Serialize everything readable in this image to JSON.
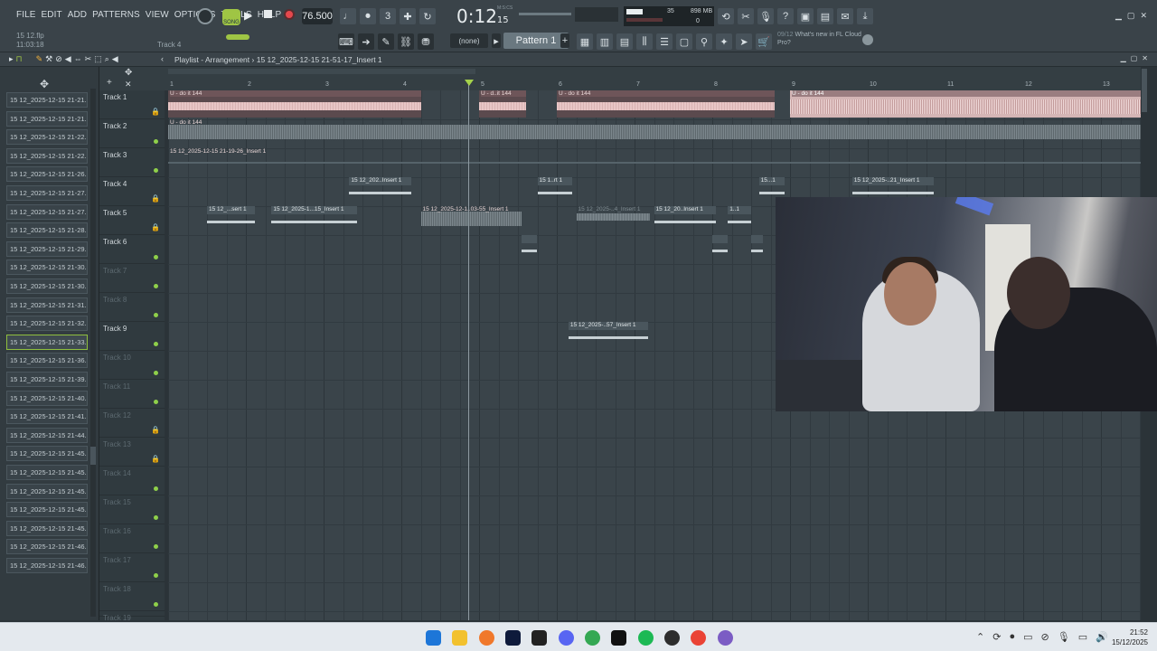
{
  "menu": [
    "FILE",
    "EDIT",
    "ADD",
    "PATTERNS",
    "VIEW",
    "OPTIONS",
    "TOOLS",
    "HELP"
  ],
  "hint": {
    "line1": "15 12.flp",
    "line2": "11:03:18",
    "track": "Track 4"
  },
  "transport": {
    "song_label": "SONG",
    "tempo": "76.500",
    "time": "0:12",
    "time_sub": "15",
    "time_unit": "M:S:CS"
  },
  "monitor": {
    "cpu": "35",
    "mem": "898 MB",
    "poly": "0"
  },
  "snap": "(none)",
  "pattern": "Pattern 1",
  "news": {
    "count": "09/12",
    "text": "What's new in FL Cloud Pro?"
  },
  "playlist": {
    "title": "Playlist - Arrangement",
    "breadcrumb": "15 12_2025-12-15 21-51-17_Insert 1"
  },
  "browser": [
    "15 12_2025-12-15 21-21..",
    "15 12_2025-12-15 21-21..",
    "15 12_2025-12-15 21-22..",
    "15 12_2025-12-15 21-22..",
    "15 12_2025-12-15 21-26..",
    "15 12_2025-12-15 21-27..",
    "15 12_2025-12-15 21-27..",
    "15 12_2025-12-15 21-28..",
    "15 12_2025-12-15 21-29..",
    "15 12_2025-12-15 21-30..",
    "15 12_2025-12-15 21-30..",
    "15 12_2025-12-15 21-31..",
    "15 12_2025-12-15 21-32..",
    "15 12_2025-12-15 21-33..",
    "15 12_2025-12-15 21-36..",
    "15 12_2025-12-15 21-39..",
    "15 12_2025-12-15 21-40..",
    "15 12_2025-12-15 21-41..",
    "15 12_2025-12-15 21-44..",
    "15 12_2025-12-15 21-45..",
    "15 12_2025-12-15 21-45..",
    "15 12_2025-12-15 21-45..",
    "15 12_2025-12-15 21-45..",
    "15 12_2025-12-15 21-45..",
    "15 12_2025-12-15 21-46..",
    "15 12_2025-12-15 21-46.."
  ],
  "browser_selected": 13,
  "tracks": [
    "Track 1",
    "Track 2",
    "Track 3",
    "Track 4",
    "Track 5",
    "Track 6",
    "Track 7",
    "Track 8",
    "Track 9",
    "Track 10",
    "Track 11",
    "Track 12",
    "Track 13",
    "Track 14",
    "Track 15",
    "Track 16",
    "Track 17",
    "Track 18",
    "Track 19"
  ],
  "track_dim": [
    false,
    false,
    false,
    false,
    false,
    false,
    true,
    true,
    false,
    true,
    true,
    true,
    true,
    true,
    true,
    true,
    true,
    true,
    true
  ],
  "track_locked": [
    true,
    false,
    false,
    true,
    true,
    false,
    false,
    false,
    false,
    false,
    false,
    true,
    true,
    false,
    false,
    false,
    false,
    false,
    false
  ],
  "ruler": [
    "1",
    "2",
    "3",
    "4",
    "5",
    "6",
    "7",
    "8",
    "9",
    "10",
    "11",
    "12",
    "13"
  ],
  "clips": [
    {
      "track": 1,
      "start": 1,
      "len": 3.25,
      "label": "U - do it 144",
      "style": "pink"
    },
    {
      "track": 1,
      "start": 5,
      "len": 0.6,
      "label": "U - d..it 144",
      "style": "pink"
    },
    {
      "track": 1,
      "start": 6,
      "len": 2.8,
      "label": "U - do it 144",
      "style": "pink"
    },
    {
      "track": 1,
      "start": 9,
      "len": 4.6,
      "label": "U - do it 144",
      "style": "big"
    },
    {
      "track": 2,
      "start": 1,
      "len": 8,
      "label": "U - do it 144",
      "style": "grey2"
    },
    {
      "track": 2,
      "start": 9,
      "len": 4.6,
      "label": "",
      "style": "grey2"
    },
    {
      "track": 3,
      "start": 1,
      "len": 12.6,
      "label": "15 12_2025-12-15 21-19-26_Insert 1",
      "style": "thin"
    },
    {
      "track": 4,
      "start": 3.33,
      "len": 0.8,
      "label": "15 12_202..Insert 1",
      "style": "sm"
    },
    {
      "track": 4,
      "start": 5.75,
      "len": 0.45,
      "label": "15 1..rt 1",
      "style": "sm"
    },
    {
      "track": 4,
      "start": 8.6,
      "len": 0.33,
      "label": "15...1",
      "style": "sm"
    },
    {
      "track": 4,
      "start": 9.8,
      "len": 1.05,
      "label": "15 12_2025-..21_Insert 1",
      "style": "sm"
    },
    {
      "track": 5,
      "start": 1.5,
      "len": 0.62,
      "label": "15 12_...sert 1",
      "style": "sm"
    },
    {
      "track": 5,
      "start": 2.33,
      "len": 1.1,
      "label": "15 12_2025-1...15_Insert 1",
      "style": "sm"
    },
    {
      "track": 5,
      "start": 4.25,
      "len": 1.3,
      "label": "15 12_2025-12-1..03-55_Insert 1",
      "style": "grey2"
    },
    {
      "track": 5,
      "start": 6.25,
      "len": 0.95,
      "label": "15 12_2025-..4_Insert 1",
      "style": "grey"
    },
    {
      "track": 5,
      "start": 7.25,
      "len": 0.8,
      "label": "15 12_20..Insert 1",
      "style": "sm"
    },
    {
      "track": 5,
      "start": 8.2,
      "len": 0.3,
      "label": "1..1",
      "style": "sm"
    },
    {
      "track": 6,
      "start": 5.55,
      "len": 0.2,
      "label": "",
      "style": "sm"
    },
    {
      "track": 6,
      "start": 8,
      "len": 0.2,
      "label": "",
      "style": "sm"
    },
    {
      "track": 6,
      "start": 8.5,
      "len": 0.15,
      "label": "",
      "style": "sm"
    },
    {
      "track": 9,
      "start": 6.15,
      "len": 1.02,
      "label": "15 12_2025-..57_Insert 1",
      "style": "sm"
    }
  ],
  "clock": {
    "time": "21:52",
    "date": "15/12/2025"
  }
}
